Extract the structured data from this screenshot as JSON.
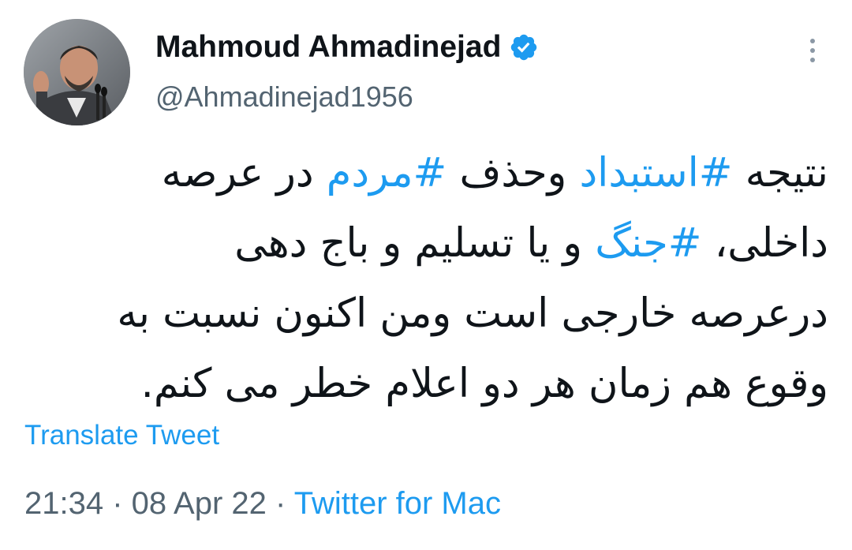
{
  "author": {
    "display_name": "Mahmoud Ahmadinejad",
    "handle": "@Ahmadinejad1956",
    "verified_icon": "verified-badge-icon",
    "avatar_icon": "profile-photo"
  },
  "tweet": {
    "lines": [
      [
        {
          "text": "نتیجه ",
          "hashtag": false
        },
        {
          "text": "#استبداد",
          "hashtag": true
        },
        {
          "text": "  وحذف ",
          "hashtag": false
        },
        {
          "text": "#مردم",
          "hashtag": true
        },
        {
          "text": " در عرصه",
          "hashtag": false
        }
      ],
      [
        {
          "text": "داخلی، ",
          "hashtag": false
        },
        {
          "text": "#جنگ",
          "hashtag": true
        },
        {
          "text": " و یا تسلیم و  باج دهی",
          "hashtag": false
        }
      ],
      [
        {
          "text": "درعرصه خارجی است ومن اکنون نسبت به",
          "hashtag": false
        }
      ],
      [
        {
          "text": "وقوع هم زمان هر دو اعلام خطر می کنم.",
          "hashtag": false
        }
      ]
    ]
  },
  "translate_label": "Translate Tweet",
  "meta": {
    "time": "21:34",
    "separator": " · ",
    "date": "08 Apr 22",
    "source": "Twitter for Mac"
  },
  "menu_icon": "more-options-icon",
  "colors": {
    "accent": "#1d9bf0",
    "text": "#0f1419",
    "secondary": "#536471"
  }
}
